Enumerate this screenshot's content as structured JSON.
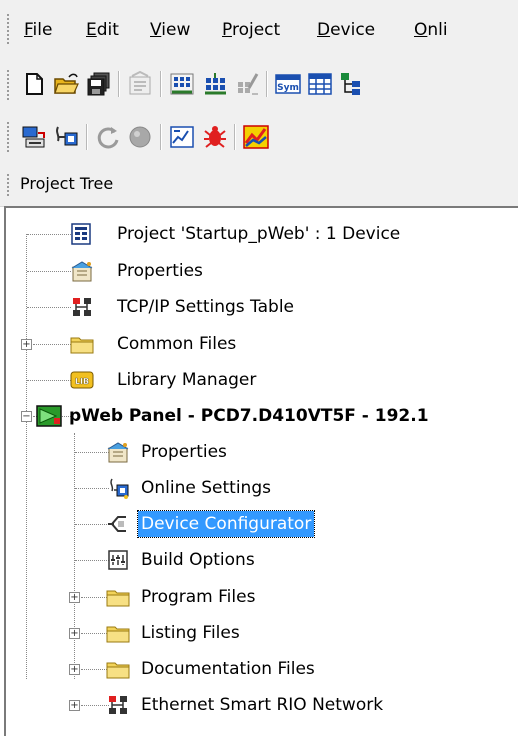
{
  "menu": {
    "items": [
      {
        "label": "File",
        "key": "F",
        "rest": "ile"
      },
      {
        "label": "Edit",
        "key": "E",
        "rest": "dit"
      },
      {
        "label": "View",
        "key": "V",
        "rest": "iew"
      },
      {
        "label": "Project",
        "key": "P",
        "rest": "roject"
      },
      {
        "label": "Device",
        "key": "D",
        "rest": "evice"
      },
      {
        "label": "Onli",
        "key": "O",
        "rest": "nli"
      }
    ]
  },
  "toolbar1": {
    "buttons": [
      "new-file-icon",
      "open-folder-icon",
      "save-all-icon",
      "properties-icon",
      "build-all-icon",
      "build-icon",
      "clean-icon",
      "symbols-icon",
      "table-icon",
      "tree-structure-icon"
    ]
  },
  "toolbar2": {
    "buttons": [
      "online-settings-icon",
      "connect-icon",
      "refresh-icon",
      "stop-icon",
      "watch-window-icon",
      "debug-icon",
      "graph-icon"
    ]
  },
  "panel": {
    "title": "Project Tree"
  },
  "tree": {
    "project": "Project 'Startup_pWeb' : 1 Device",
    "properties": "Properties",
    "tcpip": "TCP/IP Settings Table",
    "common": "Common Files",
    "library": "Library Manager",
    "device": "pWeb Panel - PCD7.D410VT5F - 192.1",
    "dev_properties": "Properties",
    "online": "Online Settings",
    "configurator": "Device Configurator",
    "build": "Build Options",
    "program": "Program Files",
    "listing": "Listing Files",
    "documentation": "Documentation Files",
    "ethernet": "Ethernet Smart RIO Network"
  },
  "colors": {
    "selection": "#3399ff",
    "folder": "#f2d35a",
    "accent_red": "#e02020",
    "accent_green": "#2a9a2a"
  }
}
